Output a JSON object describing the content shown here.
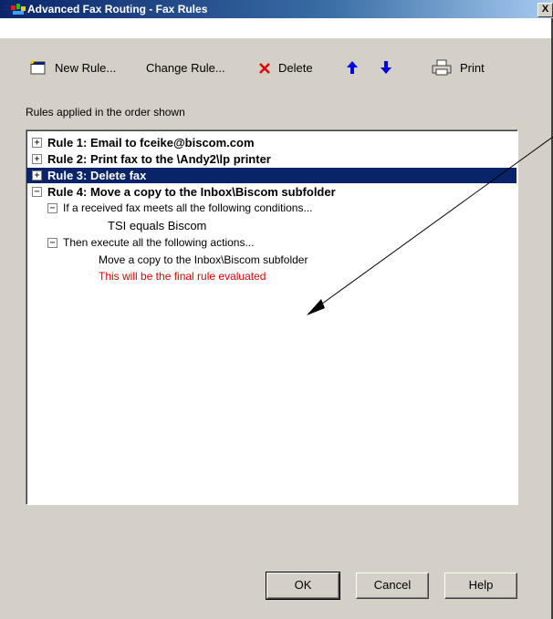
{
  "window": {
    "title": "Advanced Fax Routing - Fax Rules",
    "close_glyph": "X"
  },
  "toolbar": {
    "new_rule": "New Rule...",
    "change_rule": "Change Rule...",
    "delete": "Delete",
    "print": "Print",
    "icons": {
      "new": "new-rule-icon",
      "delete": "red-x-icon",
      "up": "arrow-up-icon",
      "down": "arrow-down-icon",
      "print": "printer-icon"
    }
  },
  "rules_caption": "Rules applied in the order shown",
  "rules": [
    {
      "label": "Rule 1: Email to fceike@biscom.com",
      "expander": "+",
      "selected": false
    },
    {
      "label": "Rule 2: Print fax to the \\Andy2\\lp printer",
      "expander": "+",
      "selected": false
    },
    {
      "label": "Rule 3: Delete fax",
      "expander": "+",
      "selected": true
    },
    {
      "label": "Rule 4: Move a copy to the Inbox\\Biscom subfolder",
      "expander": "−",
      "selected": false
    }
  ],
  "rule4_details": {
    "conditions_header": "If a received fax meets all the following conditions...",
    "condition": "TSI equals Biscom",
    "actions_header": "Then execute all the following actions...",
    "action": "Move a copy to the Inbox\\Biscom subfolder",
    "final_note": "This will be the final rule evaluated",
    "final_note_color": "#e00000"
  },
  "buttons": {
    "ok": "OK",
    "cancel": "Cancel",
    "help": "Help"
  },
  "colors": {
    "selection": "#0a246a",
    "arrow_blue": "#0000e0"
  }
}
